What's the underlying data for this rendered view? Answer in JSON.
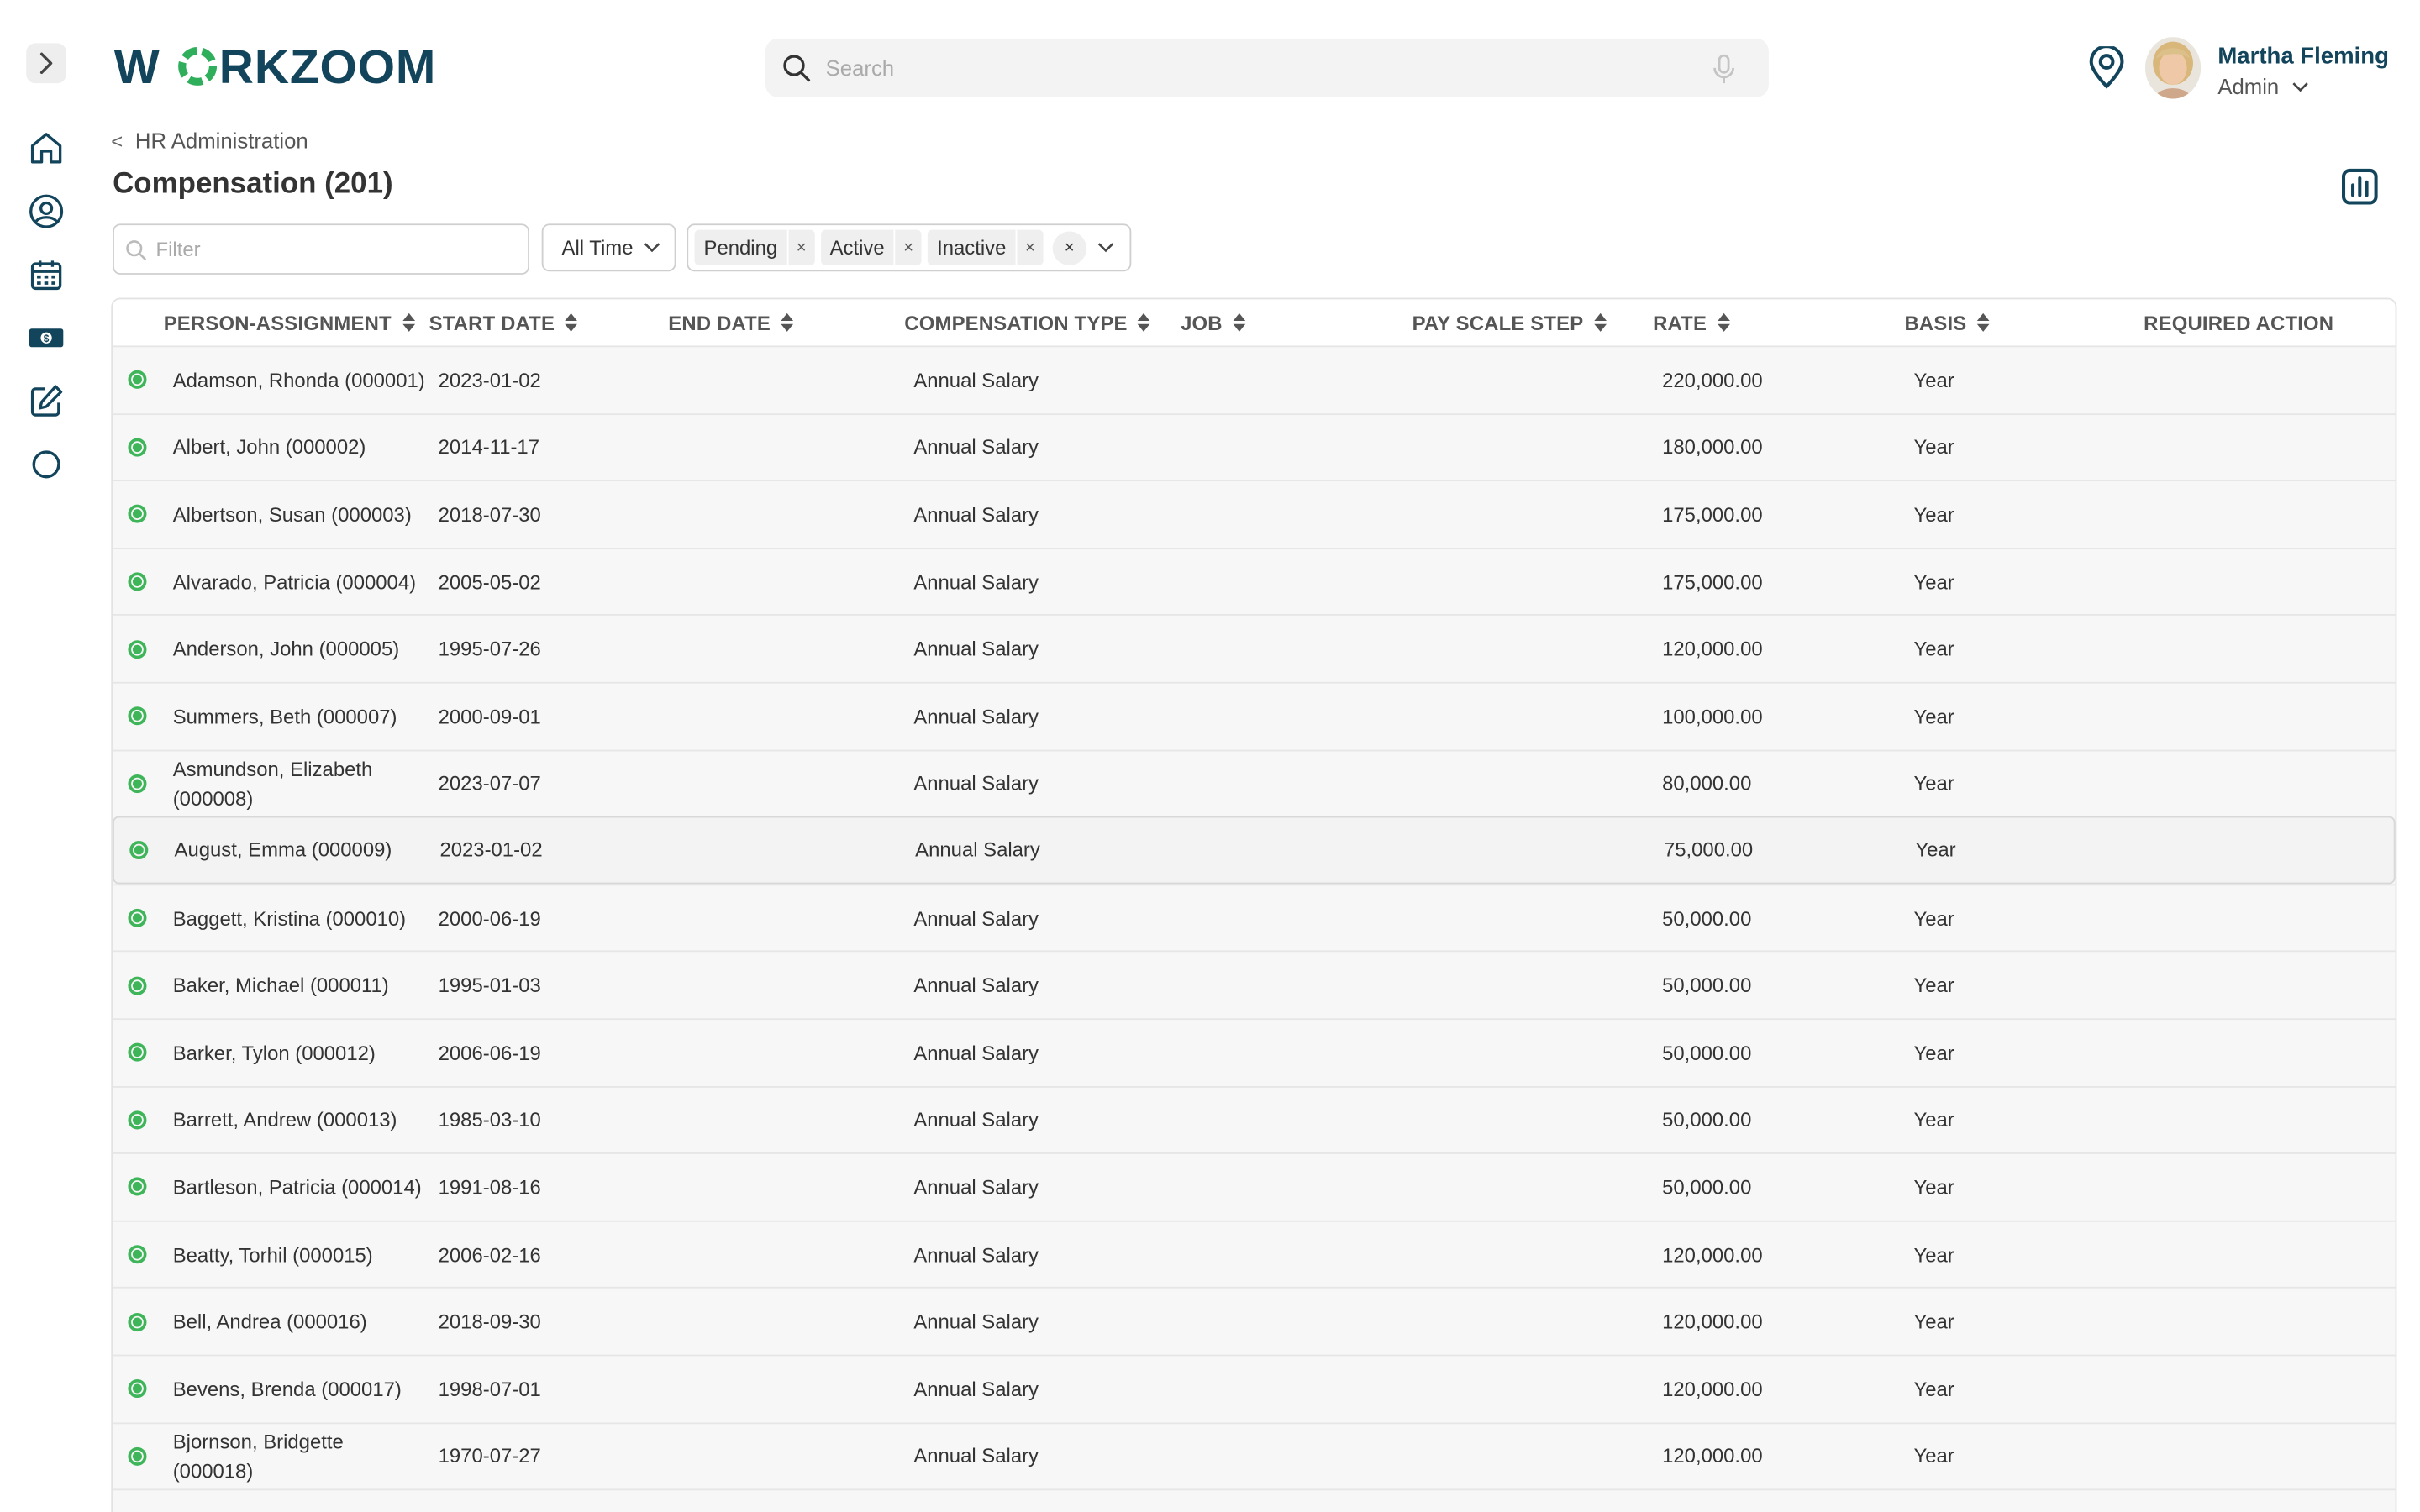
{
  "header": {
    "logo_text": "WORKZOOM",
    "search_placeholder": "Search",
    "user_name": "Martha Fleming",
    "user_role": "Admin"
  },
  "breadcrumb": {
    "back_glyph": "<",
    "label": "HR Administration"
  },
  "page_title": "Compensation (201)",
  "filter": {
    "placeholder": "Filter",
    "time_value": "All Time",
    "status_chips": [
      "Pending",
      "Active",
      "Inactive"
    ],
    "chip_remove_glyph": "×"
  },
  "sidebar_icons": [
    "expand-icon",
    "home-icon",
    "person-icon",
    "calendar-icon",
    "money-icon",
    "edit-icon",
    "refresh-icon"
  ],
  "columns": [
    "PERSON-ASSIGNMENT",
    "START DATE",
    "END DATE",
    "COMPENSATION TYPE",
    "JOB",
    "PAY SCALE STEP",
    "RATE",
    "BASIS",
    "REQUIRED ACTION"
  ],
  "rows": [
    {
      "name": "Adamson, Rhonda (000001)",
      "start": "2023-01-02",
      "type": "Annual Salary",
      "rate": "220,000.00",
      "basis": "Year"
    },
    {
      "name": "Albert, John (000002)",
      "start": "2014-11-17",
      "type": "Annual Salary",
      "rate": "180,000.00",
      "basis": "Year"
    },
    {
      "name": "Albertson, Susan (000003)",
      "start": "2018-07-30",
      "type": "Annual Salary",
      "rate": "175,000.00",
      "basis": "Year"
    },
    {
      "name": "Alvarado, Patricia (000004)",
      "start": "2005-05-02",
      "type": "Annual Salary",
      "rate": "175,000.00",
      "basis": "Year"
    },
    {
      "name": "Anderson, John (000005)",
      "start": "1995-07-26",
      "type": "Annual Salary",
      "rate": "120,000.00",
      "basis": "Year"
    },
    {
      "name": "Summers, Beth (000007)",
      "start": "2000-09-01",
      "type": "Annual Salary",
      "rate": "100,000.00",
      "basis": "Year"
    },
    {
      "name": "Asmundson, Elizabeth (000008)",
      "start": "2023-07-07",
      "type": "Annual Salary",
      "rate": "80,000.00",
      "basis": "Year"
    },
    {
      "name": "August, Emma (000009)",
      "start": "2023-01-02",
      "type": "Annual Salary",
      "rate": "75,000.00",
      "basis": "Year"
    },
    {
      "name": "Baggett, Kristina (000010)",
      "start": "2000-06-19",
      "type": "Annual Salary",
      "rate": "50,000.00",
      "basis": "Year"
    },
    {
      "name": "Baker, Michael (000011)",
      "start": "1995-01-03",
      "type": "Annual Salary",
      "rate": "50,000.00",
      "basis": "Year"
    },
    {
      "name": "Barker, Tylon (000012)",
      "start": "2006-06-19",
      "type": "Annual Salary",
      "rate": "50,000.00",
      "basis": "Year"
    },
    {
      "name": "Barrett, Andrew (000013)",
      "start": "1985-03-10",
      "type": "Annual Salary",
      "rate": "50,000.00",
      "basis": "Year"
    },
    {
      "name": "Bartleson, Patricia (000014)",
      "start": "1991-08-16",
      "type": "Annual Salary",
      "rate": "50,000.00",
      "basis": "Year"
    },
    {
      "name": "Beatty, Torhil (000015)",
      "start": "2006-02-16",
      "type": "Annual Salary",
      "rate": "120,000.00",
      "basis": "Year"
    },
    {
      "name": "Bell, Andrea (000016)",
      "start": "2018-09-30",
      "type": "Annual Salary",
      "rate": "120,000.00",
      "basis": "Year"
    },
    {
      "name": "Bevens, Brenda (000017)",
      "start": "1998-07-01",
      "type": "Annual Salary",
      "rate": "120,000.00",
      "basis": "Year"
    },
    {
      "name": "Bjornson, Bridgette (000018)",
      "start": "1970-07-27",
      "type": "Annual Salary",
      "rate": "120,000.00",
      "basis": "Year"
    }
  ],
  "colors": {
    "brand": "#12445b",
    "accent_green": "#3fb55a",
    "row_background": "#f7f7f7"
  }
}
